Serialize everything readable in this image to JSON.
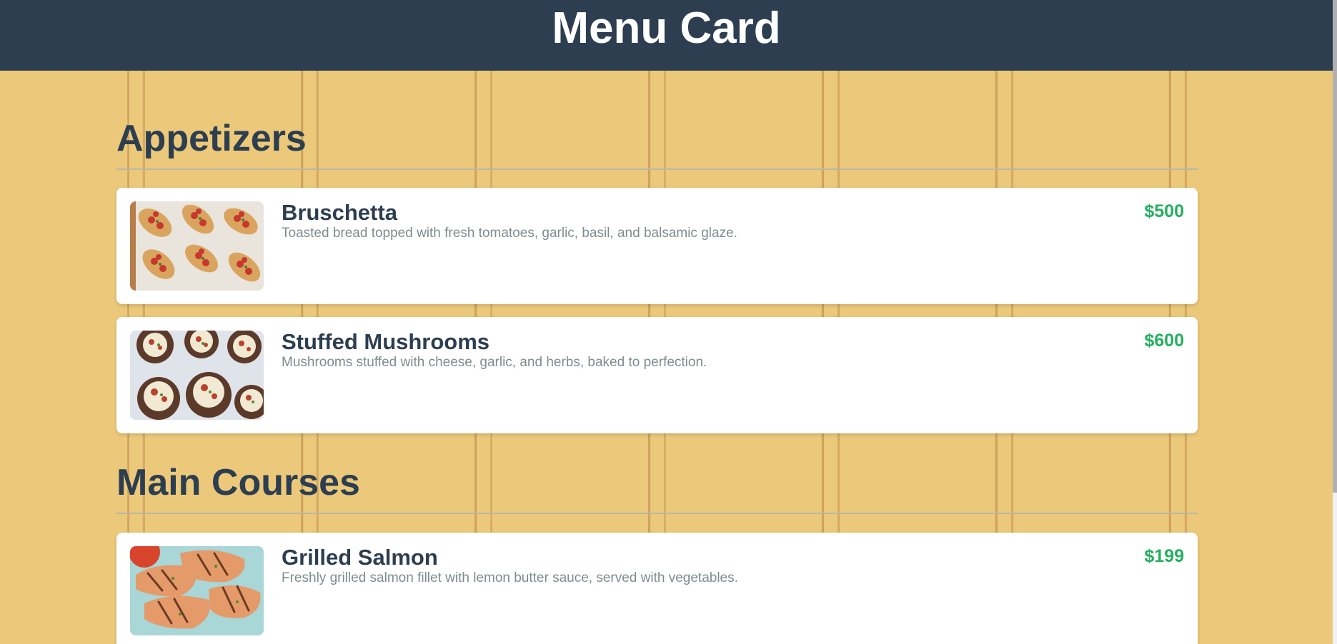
{
  "header": {
    "title": "Menu Card"
  },
  "sections": [
    {
      "title": "Appetizers",
      "items": [
        {
          "name": "Bruschetta",
          "description": "Toasted bread topped with fresh tomatoes, garlic, basil, and balsamic glaze.",
          "price": "$500"
        },
        {
          "name": "Stuffed Mushrooms",
          "description": "Mushrooms stuffed with cheese, garlic, and herbs, baked to perfection.",
          "price": "$600"
        }
      ]
    },
    {
      "title": "Main Courses",
      "items": [
        {
          "name": "Grilled Salmon",
          "description": "Freshly grilled salmon fillet with lemon butter sauce, served with vegetables.",
          "price": "$199"
        }
      ]
    }
  ],
  "colors": {
    "header_bg": "#2c3e50",
    "title_text": "#2c3e50",
    "price_text": "#27ae60",
    "description_text": "#7f8c8d",
    "page_bg": "#ecc97a"
  }
}
